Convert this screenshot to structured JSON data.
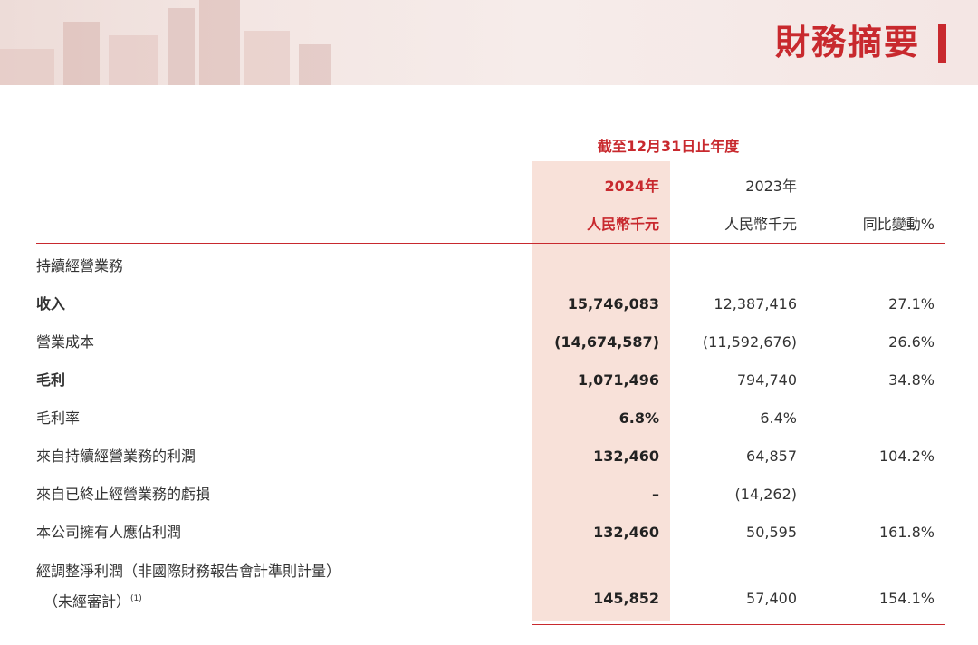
{
  "banner": {
    "title": "財務摘要",
    "accent_color": "#c8292e"
  },
  "table": {
    "period_heading": "截至12月31日止年度",
    "columns": [
      {
        "year": "2024年",
        "unit": "人民幣千元"
      },
      {
        "year": "2023年",
        "unit": "人民幣千元"
      },
      {
        "unit": "同比變動%"
      }
    ],
    "rows": [
      {
        "label": "持續經營業務",
        "v2024": "",
        "v2023": "",
        "change": ""
      },
      {
        "label": "收入",
        "v2024": "15,746,083",
        "v2023": "12,387,416",
        "change": "27.1%"
      },
      {
        "label": "營業成本",
        "v2024": "(14,674,587)",
        "v2023": "(11,592,676)",
        "change": "26.6%"
      },
      {
        "label": "毛利",
        "v2024": "1,071,496",
        "v2023": "794,740",
        "change": "34.8%"
      },
      {
        "label": "毛利率",
        "v2024": "6.8%",
        "v2023": "6.4%",
        "change": ""
      },
      {
        "label": "來自持續經營業務的利潤",
        "v2024": "132,460",
        "v2023": "64,857",
        "change": "104.2%"
      },
      {
        "label": "來自已終止經營業務的虧損",
        "v2024": "–",
        "v2023": "(14,262)",
        "change": ""
      },
      {
        "label": "本公司擁有人應佔利潤",
        "v2024": "132,460",
        "v2023": "50,595",
        "change": "161.8%"
      },
      {
        "label": "經調整淨利潤（非國際財務報告會計準則計量）",
        "label_line2": "（未經審計）",
        "footnote": "(1)",
        "v2024": "145,852",
        "v2023": "57,400",
        "change": "154.1%"
      }
    ]
  }
}
